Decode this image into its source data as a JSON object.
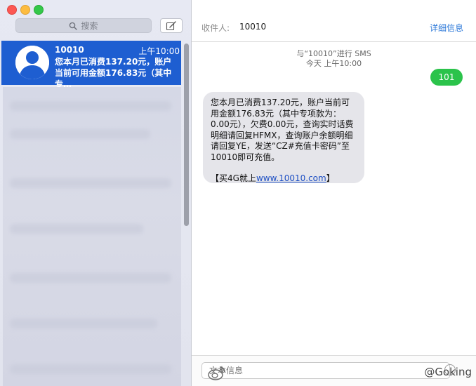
{
  "sidebar": {
    "search_placeholder": "搜索",
    "selected_conversation": {
      "name": "10010",
      "time": "上午10:00",
      "preview": "您本月已消费137.20元，账户当前可用金额176.83元（其中专…"
    }
  },
  "header": {
    "to_label": "收件人:",
    "to_value": "10010",
    "details_link": "详细信息"
  },
  "thread": {
    "service_line": "与“10010”进行 SMS",
    "date_line": "今天 上午10:00",
    "outgoing": "101",
    "incoming_text": "您本月已消费137.20元，账户当前可用金额176.83元（其中专项款为：0.00元），欠费0.00元，查询实时话费明细请回复HFMX，查询账户余额明细请回复YE，发送“CZ#充值卡密码”至10010即可充值。",
    "incoming_promo_prefix": "【买4G就上",
    "incoming_promo_link": "www.10010.com",
    "incoming_promo_suffix": "】"
  },
  "composer": {
    "placeholder": "文本信息"
  },
  "watermark": "@Goking",
  "colors": {
    "selection": "#1e5ed1",
    "outgoing_bubble": "#2bc34b",
    "incoming_bubble": "#e5e5ea",
    "link": "#2a77d8"
  }
}
